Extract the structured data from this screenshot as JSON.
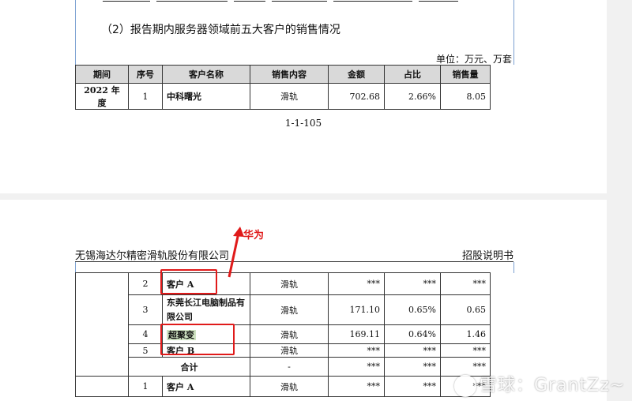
{
  "page1": {
    "subtitle": "（2）报告期内服务器领域前五大客户的销售情况",
    "unit": "单位：万元、万套",
    "table": {
      "headers": [
        "期间",
        "序号",
        "客户名称",
        "销售内容",
        "金额",
        "占比",
        "销售量"
      ],
      "row": [
        "2022 年度",
        "1",
        "中科曙光",
        "滑轨",
        "702.68",
        "2.66%",
        "8.05"
      ]
    },
    "page_number": "1-1-105"
  },
  "page2": {
    "header_left": "无锡海达尔精密滑轨股份有限公司",
    "header_right": "招股说明书",
    "annotation": "华为",
    "rows": [
      {
        "seq": "2",
        "name": "客户 A",
        "content": "滑轨",
        "amount": "***",
        "ratio": "***",
        "qty": "***"
      },
      {
        "seq": "3",
        "name": "东莞长江电脑制品有限公司",
        "content": "滑轨",
        "amount": "171.10",
        "ratio": "0.65%",
        "qty": "0.65"
      },
      {
        "seq": "4",
        "name": "超聚变",
        "content": "滑轨",
        "amount": "169.11",
        "ratio": "0.64%",
        "qty": "1.46"
      },
      {
        "seq": "5",
        "name": "客户 B",
        "content": "滑轨",
        "amount": "***",
        "ratio": "***",
        "qty": "***"
      },
      {
        "seq": "",
        "name": "合计",
        "content": "-",
        "amount": "***",
        "ratio": "***",
        "qty": "***"
      },
      {
        "seq": "1",
        "name": "客户 A",
        "content": "滑轨",
        "amount": "***",
        "ratio": "***",
        "qty": "***"
      }
    ]
  },
  "watermark": "雪球：GrantZz~",
  "colors": {
    "annotation_red": "#e01a1a",
    "highlight_green": "#cfe3c2",
    "table_header_gray": "#d9d9d9"
  }
}
